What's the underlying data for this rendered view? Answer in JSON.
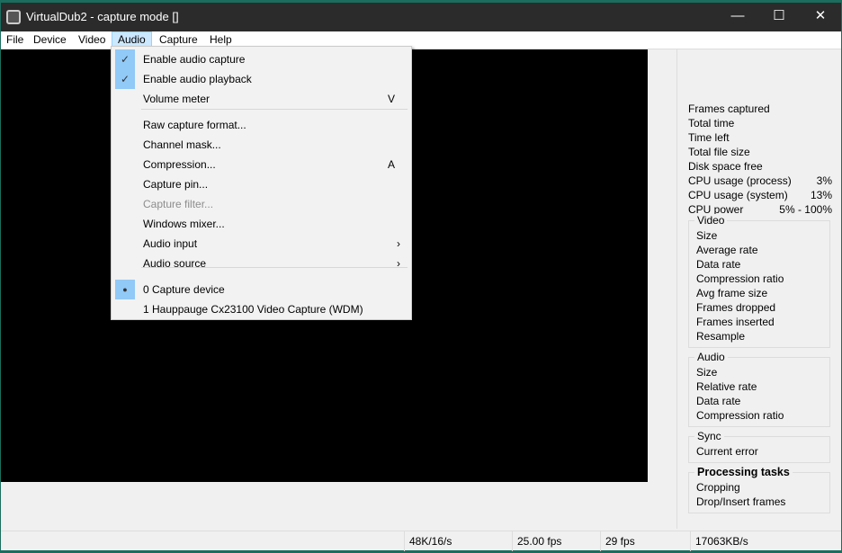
{
  "window": {
    "title": "VirtualDub2  - capture mode []",
    "minimize": "—",
    "maximize": "☐",
    "close": "✕"
  },
  "menu": [
    "File",
    "Device",
    "Video",
    "Audio",
    "Capture",
    "Help"
  ],
  "audio_menu": [
    {
      "label": "Enable audio capture",
      "checked": true,
      "mark": "✓"
    },
    {
      "label": "Enable audio playback",
      "checked": true,
      "mark": "✓"
    },
    {
      "label": "Volume meter",
      "shortcut": "V"
    },
    {
      "label": "Raw capture format..."
    },
    {
      "label": "Channel mask..."
    },
    {
      "label": "Compression...",
      "shortcut": "A"
    },
    {
      "label": "Capture pin..."
    },
    {
      "label": "Capture filter...",
      "disabled": true
    },
    {
      "label": "Windows mixer..."
    },
    {
      "label": "Audio input",
      "submenu": "›"
    },
    {
      "label": "Audio source",
      "submenu": "›"
    },
    {
      "label": "0 Capture device",
      "mark": "●"
    },
    {
      "label": "1 Hauppauge Cx23100 Video Capture (WDM)"
    }
  ],
  "stats": [
    {
      "label": "Frames captured",
      "value": ""
    },
    {
      "label": "Total time",
      "value": ""
    },
    {
      "label": "Time left",
      "value": ""
    },
    {
      "label": "Total file size",
      "value": ""
    },
    {
      "label": "Disk space free",
      "value": ""
    },
    {
      "label": "CPU usage (process)",
      "value": "3%"
    },
    {
      "label": "CPU usage (system)",
      "value": "13%"
    },
    {
      "label": "CPU power",
      "value": "5% - 100%"
    }
  ],
  "video_group": {
    "title": "Video",
    "items": [
      "Size",
      "Average rate",
      "Data rate",
      "Compression ratio",
      "Avg frame size",
      "Frames dropped",
      "Frames inserted",
      "Resample"
    ]
  },
  "audio_group": {
    "title": "Audio",
    "items": [
      "Size",
      "Relative rate",
      "Data rate",
      "Compression ratio"
    ]
  },
  "sync_group": {
    "title": "Sync",
    "items": [
      "Current error"
    ]
  },
  "tasks_group": {
    "title": "Processing tasks",
    "items": [
      "Cropping",
      "Drop/Insert frames"
    ]
  },
  "status": [
    "48K/16/s",
    "25.00 fps",
    "29 fps",
    "17063KB/s"
  ]
}
